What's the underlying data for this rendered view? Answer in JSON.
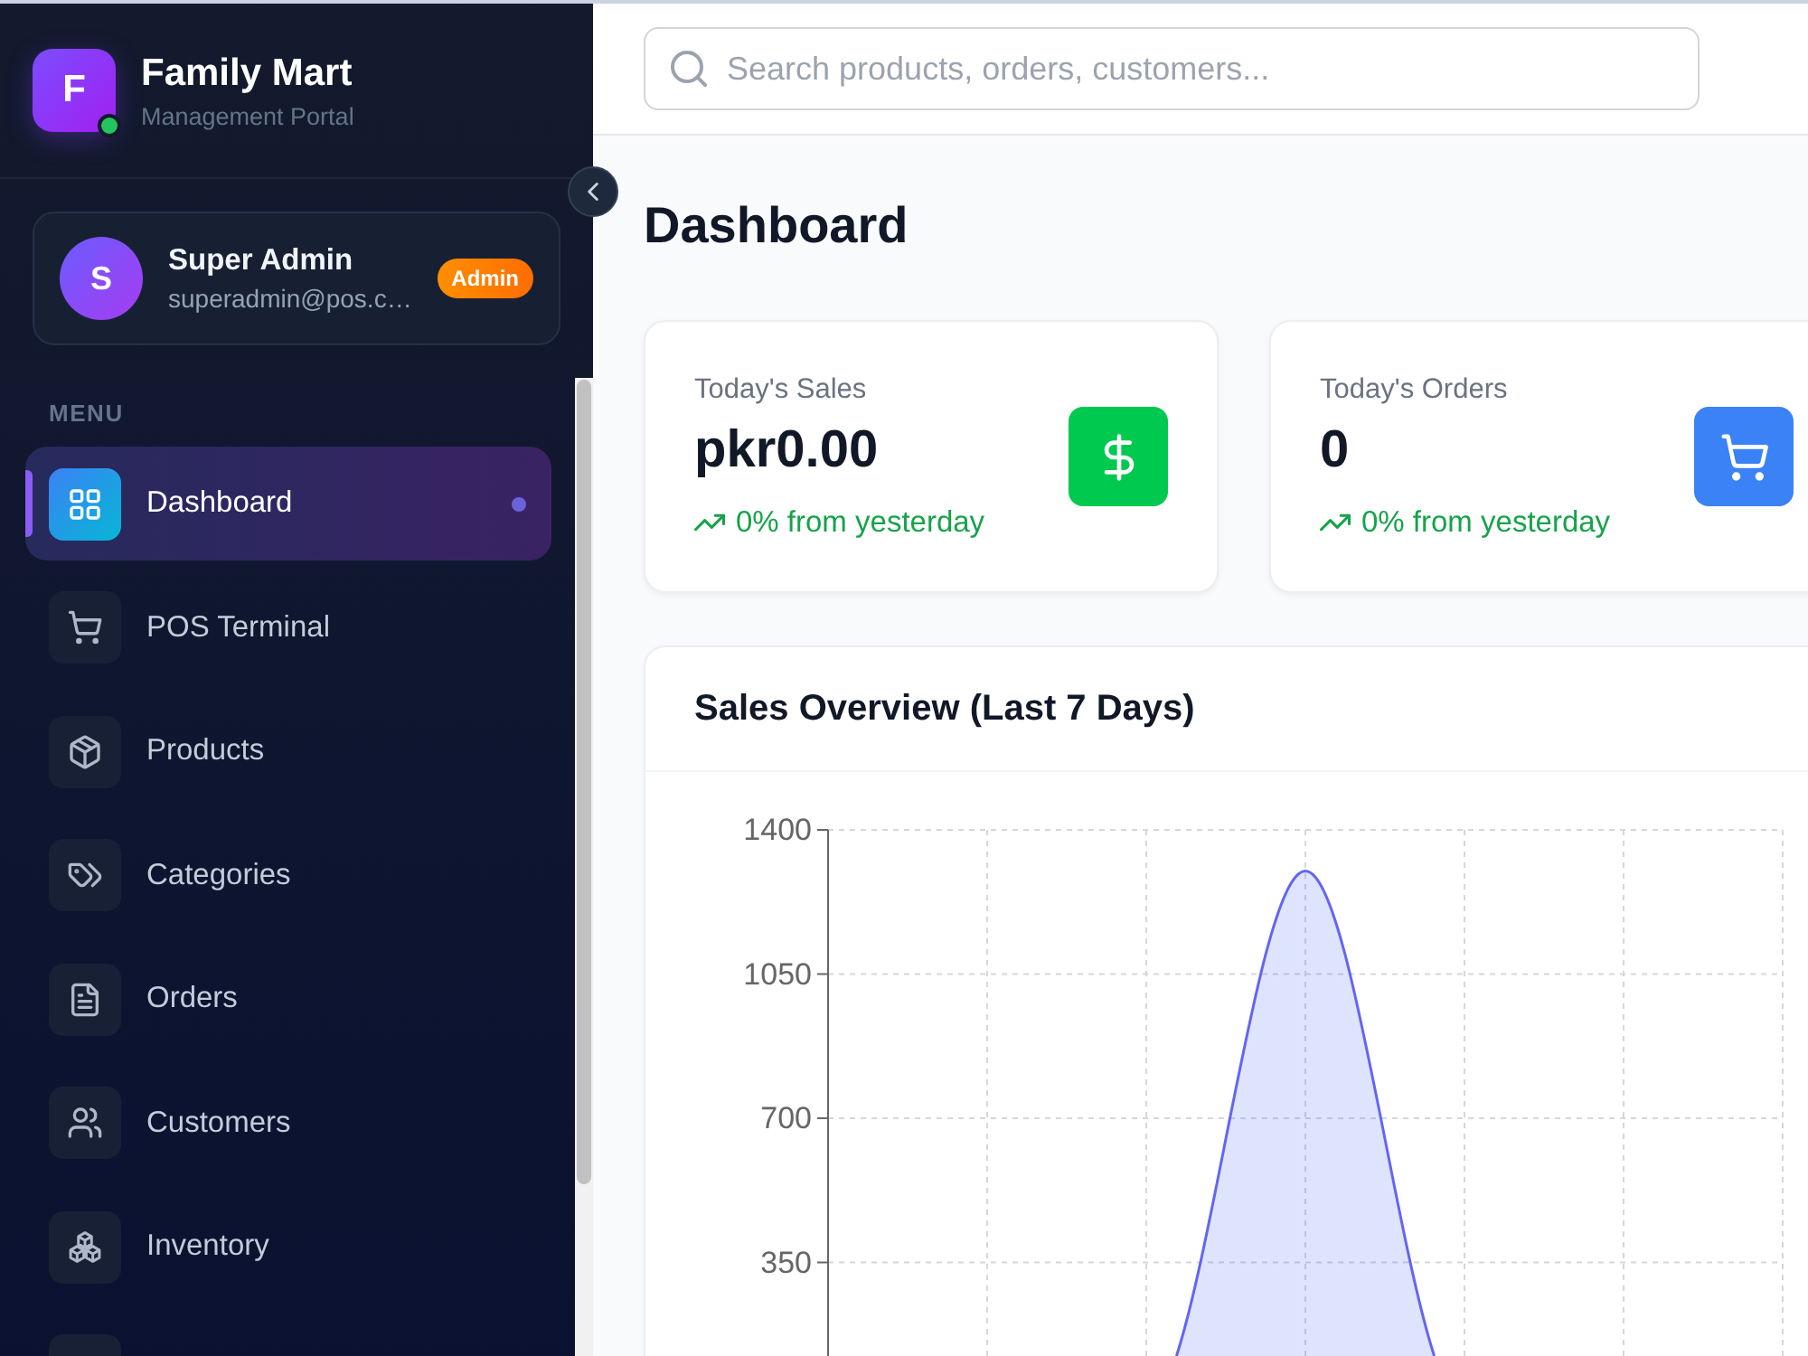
{
  "brand": {
    "initial": "F",
    "name": "Family Mart",
    "subtitle": "Management Portal",
    "online": true
  },
  "user": {
    "initial": "S",
    "name": "Super Admin",
    "email": "superadmin@pos.c…",
    "role": "Admin"
  },
  "menu": {
    "heading": "MENU",
    "items": [
      {
        "label": "Dashboard",
        "selected": true
      },
      {
        "label": "POS Terminal",
        "selected": false
      },
      {
        "label": "Products",
        "selected": false
      },
      {
        "label": "Categories",
        "selected": false
      },
      {
        "label": "Orders",
        "selected": false
      },
      {
        "label": "Customers",
        "selected": false
      },
      {
        "label": "Inventory",
        "selected": false
      },
      {
        "selected": false
      }
    ]
  },
  "search": {
    "placeholder": "Search products, orders, customers..."
  },
  "page_title": "Dashboard",
  "stats": [
    {
      "label": "Today's Sales",
      "value": "pkr0.00",
      "trend": "0% from yesterday",
      "color": "#00c950"
    },
    {
      "label": "Today's Orders",
      "value": "0",
      "trend": "0% from yesterday",
      "color": "#3b82f6"
    }
  ],
  "sales_chart": {
    "title": "Sales Overview (Last 7 Days)",
    "y_axis_labels": [
      "1400",
      "1050",
      "700",
      "350"
    ]
  }
}
